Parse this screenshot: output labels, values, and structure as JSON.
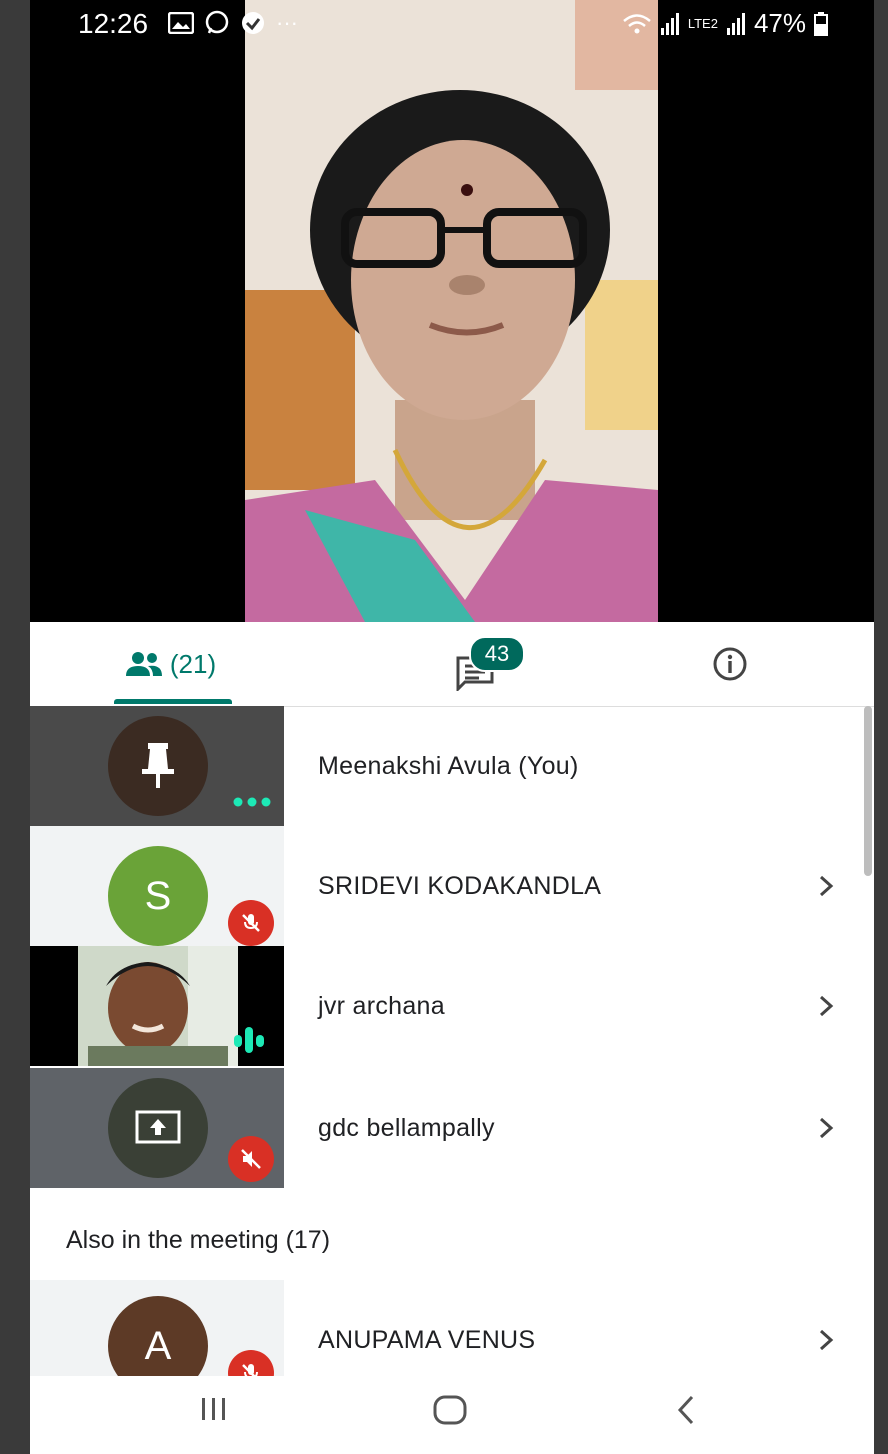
{
  "status_bar": {
    "time": "12:26",
    "battery": "47%",
    "network_label": "LTE2"
  },
  "tabs": {
    "people_count": "(21)",
    "chat_badge": "43"
  },
  "participants": [
    {
      "name": "Meenakshi Avula (You)",
      "tile": "pinned-self",
      "has_chevron": false
    },
    {
      "name": "SRIDEVI KODAKANDLA",
      "tile": "avatar",
      "avatar_letter": "S",
      "avatar_color": "#6aa338",
      "muted": true,
      "has_chevron": true
    },
    {
      "name": "jvr archana",
      "tile": "video",
      "speaking": true,
      "has_chevron": true
    },
    {
      "name": "gdc bellampally",
      "tile": "screen-share",
      "muted": true,
      "has_chevron": true
    }
  ],
  "also_in_meeting": {
    "label": "Also in the meeting (17)",
    "items": [
      {
        "name": "ANUPAMA VENUS",
        "avatar_letter": "A",
        "avatar_color": "#5d3a26",
        "muted": true,
        "has_chevron": true
      }
    ]
  },
  "colors": {
    "accent": "#00796b",
    "badge": "#00695c",
    "mic_off": "#d93025",
    "speaking": "#1de9b6"
  }
}
